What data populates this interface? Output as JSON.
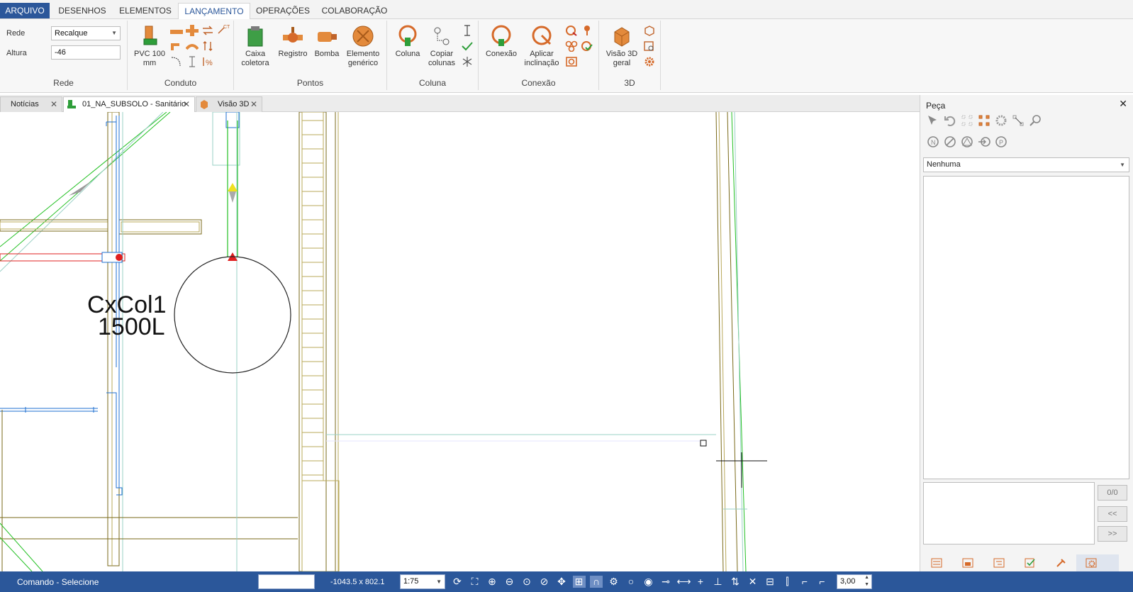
{
  "ribbon_tabs": [
    "ARQUIVO",
    "DESENHOS",
    "ELEMENTOS",
    "LANÇAMENTO",
    "OPERAÇÕES",
    "COLABORAÇÃO"
  ],
  "rede_group": {
    "rede_label": "Rede",
    "rede_value": "Recalque",
    "altura_label": "Altura",
    "altura_value": "-46",
    "group_label": "Rede"
  },
  "conduto_group": {
    "pvc_label": "PVC 100 mm",
    "group_label": "Conduto"
  },
  "pontos_group": {
    "caixa_label": "Caixa coletora",
    "registro_label": "Registro",
    "bomba_label": "Bomba",
    "elemento_label": "Elemento genérico",
    "group_label": "Pontos"
  },
  "coluna_group": {
    "coluna_label": "Coluna",
    "copiar_label": "Copiar colunas",
    "group_label": "Coluna"
  },
  "conexao_group": {
    "conexao_label": "Conexão",
    "aplicar_label": "Aplicar inclinação",
    "group_label": "Conexão"
  },
  "threed_group": {
    "visao_label": "Visão 3D geral",
    "group_label": "3D"
  },
  "doc_tabs": [
    "Notícias",
    "01_NA_SUBSOLO - Sanitário",
    "Visão 3D"
  ],
  "drawing": {
    "label_line1": "CxCol1",
    "label_line2": "1500L"
  },
  "panel": {
    "title": "Peça",
    "selection": "Nenhuma",
    "counter": "0/0",
    "prev_label": "<<",
    "next_label": ">>"
  },
  "status": {
    "command": "Comando - Selecione",
    "coords": "-1043.5 x 802.1",
    "scale": "1:75",
    "step": "3,00"
  },
  "colors": {
    "accent": "#2b579a",
    "wall": "#7a6a1a",
    "pipe_green": "#22c022",
    "pipe_red": "#e02020",
    "pipe_blue": "#1e6fd0"
  }
}
